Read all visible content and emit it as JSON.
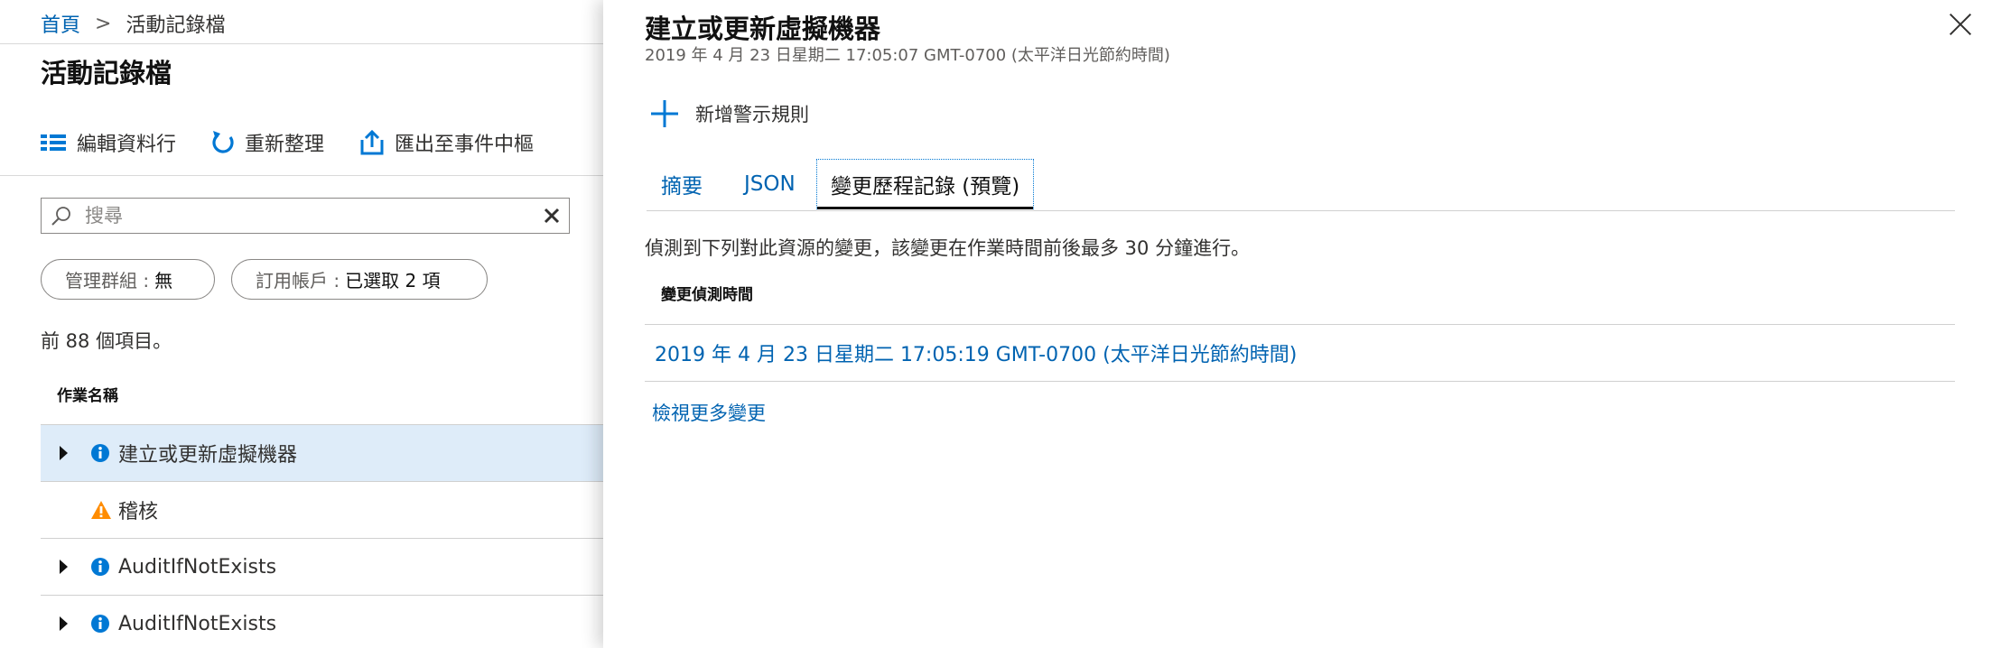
{
  "breadcrumb": {
    "home": "首頁",
    "separator": ">",
    "current": "活動記錄檔"
  },
  "left": {
    "title": "活動記錄檔",
    "toolbar": {
      "edit_columns": "編輯資料行",
      "refresh": "重新整理",
      "export": "匯出至事件中樞"
    },
    "search": {
      "placeholder": "搜尋",
      "value": ""
    },
    "filters": {
      "management_group": {
        "label": "管理群組 :",
        "value": "無"
      },
      "subscription": {
        "label": "訂用帳戶 :",
        "value": "已選取 2 項"
      }
    },
    "count_text": "前 88 個項目。",
    "column_header": "作業名稱",
    "operations": [
      {
        "label": "建立或更新虛擬機器",
        "icon": "info-icon",
        "expandable": true,
        "selected": true
      },
      {
        "label": "稽核",
        "icon": "warning-icon",
        "expandable": false,
        "selected": false
      },
      {
        "label": "AuditIfNotExists",
        "icon": "info-icon",
        "expandable": true,
        "selected": false
      },
      {
        "label": "AuditIfNotExists",
        "icon": "info-icon",
        "expandable": true,
        "selected": false
      }
    ]
  },
  "detail": {
    "title": "建立或更新虛擬機器",
    "subtitle": "2019 年 4 月 23 日星期二 17:05:07 GMT-0700 (太平洋日光節約時間)",
    "add_alert_rule": "新增警示規則",
    "tabs": [
      "摘要",
      "JSON",
      "變更歷程記錄 (預覽)"
    ],
    "active_tab": "變更歷程記錄 (預覽)",
    "info_text": "偵測到下列對此資源的變更，該變更在作業時間前後最多 30 分鐘進行。",
    "change_header": "變更偵測時間",
    "change_time": "2019 年 4 月 23 日星期二 17:05:19 GMT-0700 (太平洋日光節約時間)",
    "more_changes": "檢視更多變更"
  },
  "colors": {
    "link": "#0063b1",
    "icon_blue": "#0078d4",
    "warning": "#ff8c00",
    "selected_row": "#deecf9"
  }
}
